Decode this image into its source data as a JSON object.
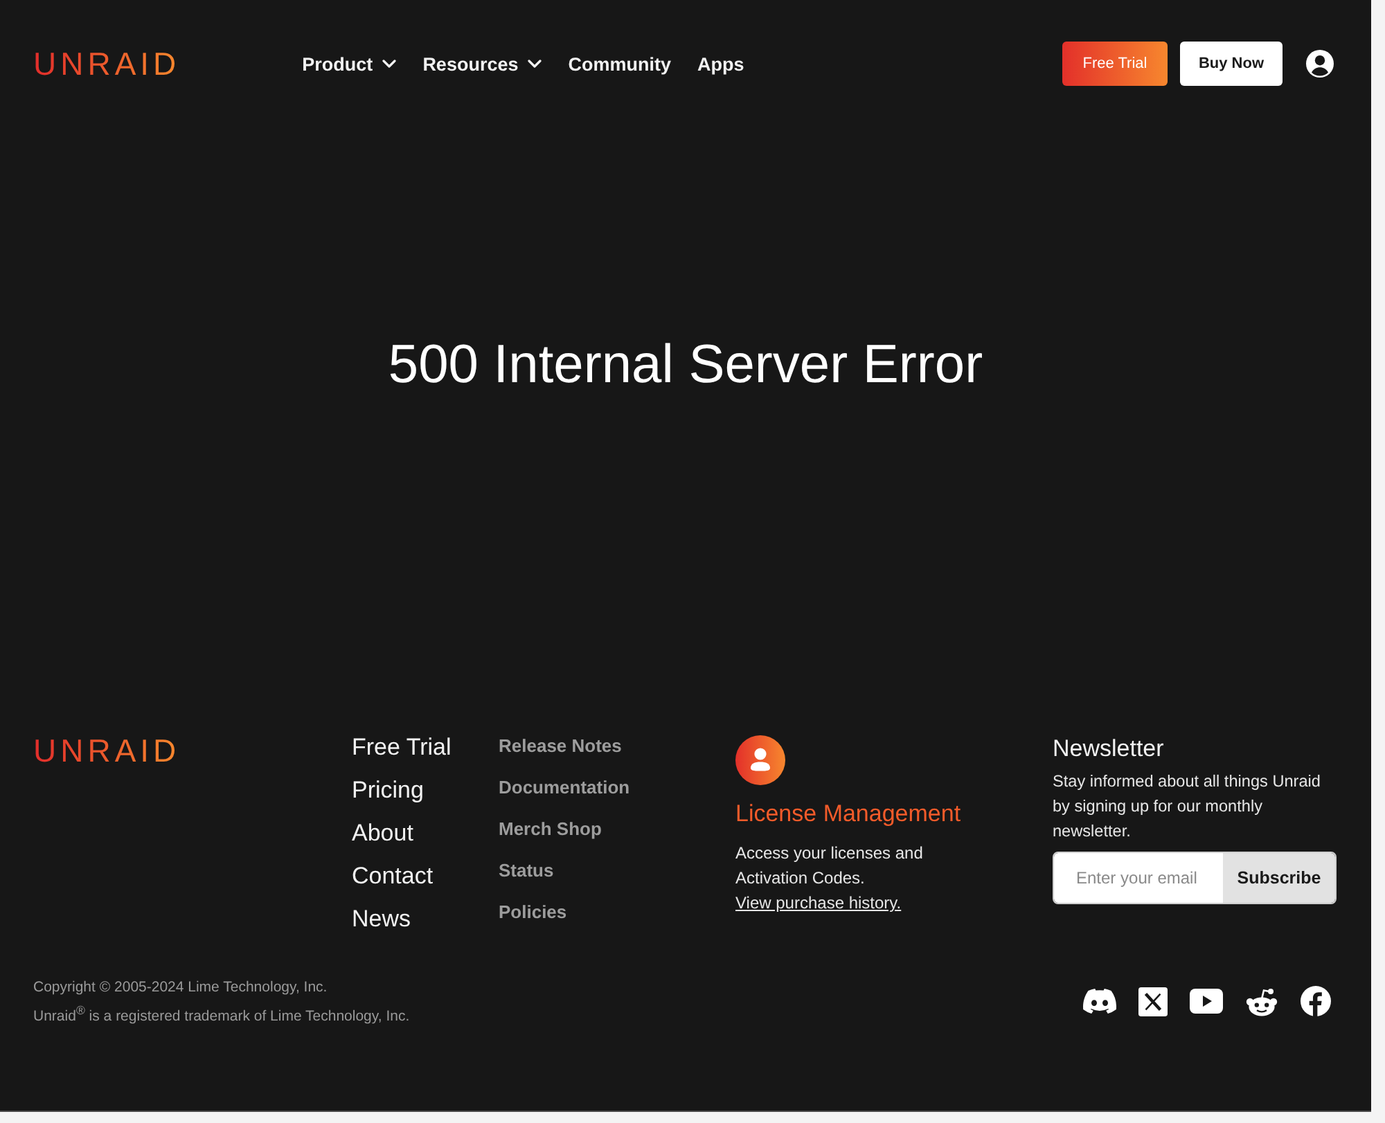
{
  "header": {
    "logo": "UNRAID",
    "nav": [
      {
        "label": "Product",
        "dropdown": true
      },
      {
        "label": "Resources",
        "dropdown": true
      },
      {
        "label": "Community",
        "dropdown": false
      },
      {
        "label": "Apps",
        "dropdown": false
      }
    ],
    "buttons": [
      {
        "label": "Free Trial",
        "kind": "primary"
      },
      {
        "label": "Buy Now",
        "kind": "secondary"
      }
    ]
  },
  "main": {
    "heading": "500 Internal Server Error"
  },
  "footer": {
    "logo": "UNRAID",
    "primary_links": [
      "Free Trial",
      "Pricing",
      "About",
      "Contact",
      "News"
    ],
    "secondary_links": [
      "Release Notes",
      "Documentation",
      "Merch Shop",
      "Status",
      "Policies"
    ],
    "license": {
      "title": "License Management",
      "text": "Access your licenses and Activation Codes.",
      "link": "View purchase history."
    },
    "newsletter": {
      "title": "Newsletter",
      "text": "Stay informed about all things Unraid by signing up for our monthly newsletter.",
      "placeholder": "Enter your email",
      "button": "Subscribe"
    },
    "copyright": "Copyright © 2005-2024 Lime Technology, Inc.",
    "trademark": "Unraid$^{®}$ is a registered trademark of Lime Technology, Inc."
  }
}
